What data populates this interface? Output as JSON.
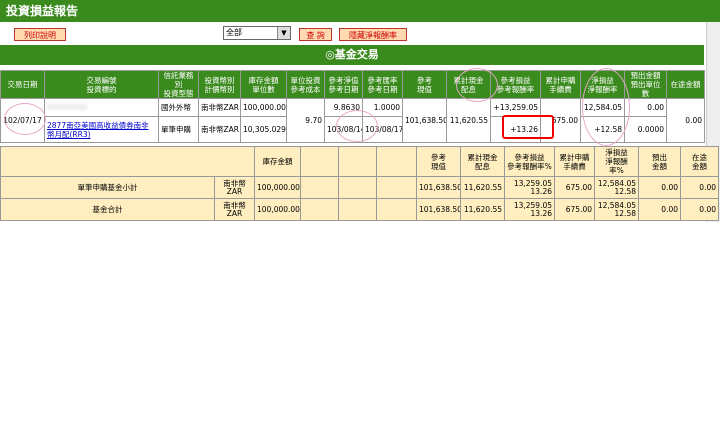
{
  "title": "投資損益報告",
  "toolbar": {
    "print_label": "列印說明",
    "query_label": "查 詢",
    "hide_label": "隱藏淨報酬率",
    "filter_value": "全部"
  },
  "section_title": "◎基金交易",
  "headers": [
    "交易日期",
    "交易編號\n投資標的",
    "信託業務別\n投資型態",
    "投資幣別\n計價幣別",
    "庫存金額\n單位數",
    "單位投資\n參考成本",
    "參考淨值\n參考日期",
    "參考匯率\n參考日期",
    "參考\n現值",
    "累計現金\n配息",
    "參考損益\n參考報酬率",
    "累計申購\n手續費",
    "淨損益\n淨報酬率",
    "預出金額\n預出單位數",
    "在途金額"
  ],
  "row": {
    "date": "102/07/17",
    "fund_name": "2877南亞美國高收益債券南非幣月配(RR3)",
    "type1": "國外外幣",
    "type2": "單筆申購",
    "cur1": "南非幣ZAR",
    "cur2": "南非幣ZAR",
    "amount": "100,000.00",
    "units": "10,305.0290",
    "unit_cost": "9.70",
    "nav": "9.8630",
    "nav_date": "103/08/14",
    "fx": "1.0000",
    "fx_date": "103/08/17",
    "value": "101,638.50",
    "dividend": "11,620.55",
    "pl": "+13,259.05",
    "pl_rate": "+13.26",
    "fee": "675.00",
    "net_pl": "12,584.05",
    "net_rate": "+12.58",
    "out_amt": "0.00",
    "out_units": "0.0000",
    "transit": "0.00"
  },
  "summary_headers": {
    "stock": "庫存金額",
    "value": "參考\n現值",
    "dividend": "累計現金\n配息",
    "pl": "參考損益\n參考報酬率%",
    "fee": "累計申購\n手續費",
    "net": "淨損益\n淨報酬\n率%",
    "out": "預出\n金額",
    "transit": "在途\n金額"
  },
  "subtotal": {
    "label": "單筆申購基金小計",
    "cur": "南非幣\nZAR",
    "amount": "100,000.00",
    "value": "101,638.50",
    "dividend": "11,620.55",
    "pl": "13,259.05",
    "pl_rate": "13.26",
    "fee": "675.00",
    "net": "12,584.05",
    "net_rate": "12.58",
    "out": "0.00",
    "transit": "0.00"
  },
  "total": {
    "label": "基金合計",
    "cur": "南非幣\nZAR",
    "amount": "100,000.00",
    "value": "101,638.50",
    "dividend": "11,620.55",
    "pl": "13,259.05",
    "pl_rate": "13.26",
    "fee": "675.00",
    "net": "12,584.05",
    "net_rate": "12.58",
    "out": "0.00",
    "transit": "0.00"
  }
}
